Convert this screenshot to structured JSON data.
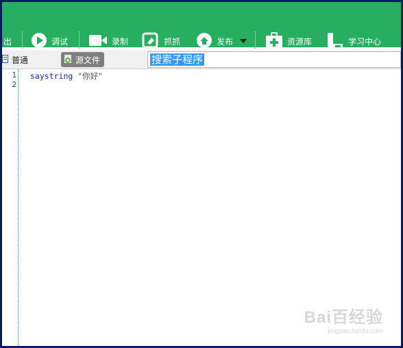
{
  "toolbar": {
    "items": [
      {
        "label": "出"
      },
      {
        "label": "调试",
        "icon": "play-icon"
      },
      {
        "label": "录制",
        "icon": "video-camera-icon"
      },
      {
        "label": "抓抓",
        "icon": "grab-icon"
      },
      {
        "label": "发布",
        "icon": "publish-icon"
      },
      {
        "label": "资源库",
        "icon": "medkit-icon"
      },
      {
        "label": "学习中心",
        "icon": "learning-icon"
      }
    ]
  },
  "tabs": {
    "normal": "普通",
    "source": "源文件"
  },
  "search": {
    "value": "搜索子程序"
  },
  "editor": {
    "line_numbers": [
      "1",
      "2"
    ],
    "lines": [
      {
        "keyword": "saystring",
        "string": "\"你好\""
      }
    ]
  },
  "watermark": {
    "logo": "Bai百经验",
    "url": "jingyan.baidu.com"
  },
  "colors": {
    "toolbar_bg": "#27ae60",
    "selection": "#3399ff",
    "tab_active": "#7f7f7f",
    "border": "#0a1a5c"
  }
}
